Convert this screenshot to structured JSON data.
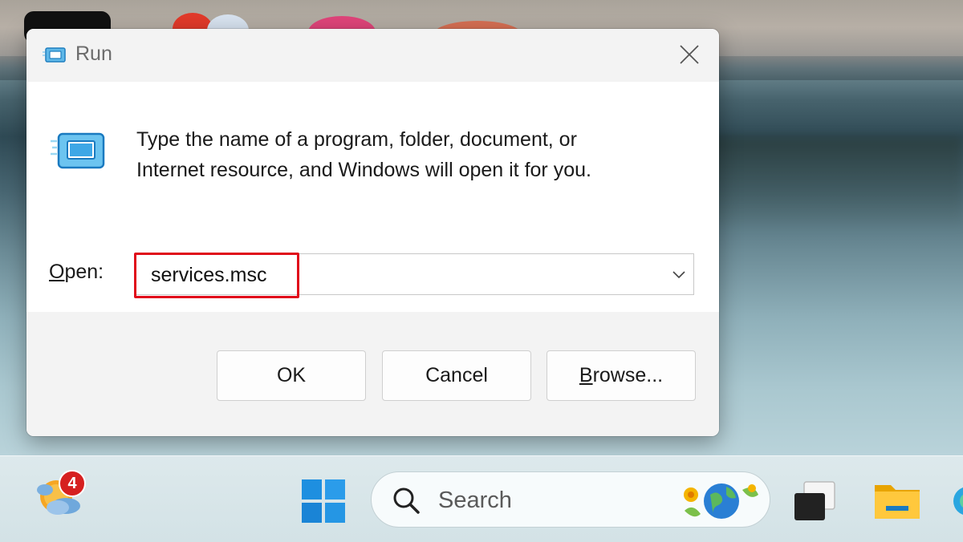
{
  "dialog": {
    "title": "Run",
    "prompt_line1": "Type the name of a program, folder, document, or",
    "prompt_line2": "Internet resource, and Windows will open it for you.",
    "open_label_accel": "O",
    "open_label_rest": "pen:",
    "open_value": "services.msc",
    "buttons": {
      "ok": "OK",
      "cancel": "Cancel",
      "browse_accel": "B",
      "browse_rest": "rowse..."
    },
    "highlight_color": "#e0091a"
  },
  "taskbar": {
    "notification_count": "4",
    "search_placeholder": "Search",
    "icons": [
      "weather-icon",
      "windows-start-icon",
      "search-icon",
      "task-view-icon",
      "file-explorer-icon",
      "edge-icon"
    ]
  },
  "colors": {
    "dialog_bg": "#f3f3f3",
    "content_bg": "#ffffff",
    "accent_blue": "#0078d4",
    "badge_red": "#d62020"
  }
}
